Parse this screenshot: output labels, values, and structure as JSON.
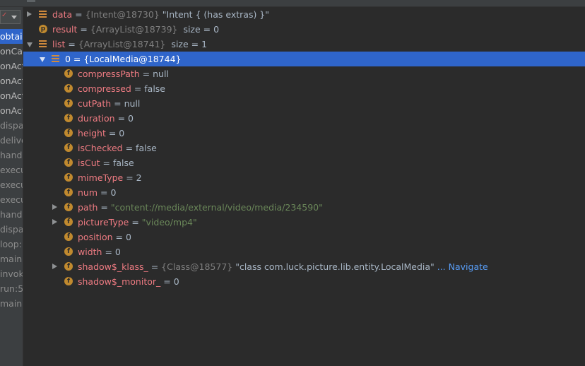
{
  "frames": [
    {
      "label": "obtai",
      "selected": true,
      "library": false
    },
    {
      "label": "onCa",
      "selected": false,
      "library": false
    },
    {
      "label": "onAct",
      "selected": false,
      "library": false
    },
    {
      "label": "onAct",
      "selected": false,
      "library": false
    },
    {
      "label": "onAct",
      "selected": false,
      "library": false
    },
    {
      "label": "onAct",
      "selected": false,
      "library": false
    },
    {
      "label": "dispa",
      "selected": false,
      "library": true
    },
    {
      "label": "delive",
      "selected": false,
      "library": true
    },
    {
      "label": "handl",
      "selected": false,
      "library": true
    },
    {
      "label": "execu",
      "selected": false,
      "library": true
    },
    {
      "label": "execu",
      "selected": false,
      "library": true
    },
    {
      "label": "execu",
      "selected": false,
      "library": true
    },
    {
      "label": "handl",
      "selected": false,
      "library": true
    },
    {
      "label": "dispa",
      "selected": false,
      "library": true
    },
    {
      "label": "loop:",
      "selected": false,
      "library": true
    },
    {
      "label": "main:",
      "selected": false,
      "library": true
    },
    {
      "label": "invok",
      "selected": false,
      "library": true
    },
    {
      "label": "run:5",
      "selected": false,
      "library": true
    },
    {
      "label": "main:",
      "selected": false,
      "library": true
    }
  ],
  "variables": [
    {
      "depth": 0,
      "toggle": "collapsed",
      "icon": "v",
      "name": "data",
      "eq": " = ",
      "ref": "{Intent@18730}",
      "value": " \"Intent { (has extras) }\"",
      "vclass": "v2",
      "selected": false
    },
    {
      "depth": 0,
      "toggle": "none",
      "icon": "p",
      "name": "result",
      "eq": " = ",
      "ref": "{ArrayList@18739}",
      "value": "  size = 0",
      "vclass": "v2",
      "selected": false
    },
    {
      "depth": 0,
      "toggle": "expanded",
      "icon": "v",
      "name": "list",
      "eq": " = ",
      "ref": "{ArrayList@18741}",
      "value": "  size = 1",
      "vclass": "v2",
      "selected": false
    },
    {
      "depth": 1,
      "toggle": "expanded",
      "icon": "v",
      "name": "0",
      "eq": " = ",
      "ref": "{LocalMedia@18744}",
      "value": "",
      "vclass": "v2",
      "selected": true
    },
    {
      "depth": 2,
      "toggle": "none",
      "icon": "f",
      "name": "compressPath",
      "eq": " = ",
      "ref": "",
      "value": "null",
      "vclass": "v2",
      "selected": false
    },
    {
      "depth": 2,
      "toggle": "none",
      "icon": "f",
      "name": "compressed",
      "eq": " = ",
      "ref": "",
      "value": "false",
      "vclass": "v2",
      "selected": false
    },
    {
      "depth": 2,
      "toggle": "none",
      "icon": "f",
      "name": "cutPath",
      "eq": " = ",
      "ref": "",
      "value": "null",
      "vclass": "v2",
      "selected": false
    },
    {
      "depth": 2,
      "toggle": "none",
      "icon": "f",
      "name": "duration",
      "eq": " = ",
      "ref": "",
      "value": "0",
      "vclass": "v2",
      "selected": false
    },
    {
      "depth": 2,
      "toggle": "none",
      "icon": "f",
      "name": "height",
      "eq": " = ",
      "ref": "",
      "value": "0",
      "vclass": "v2",
      "selected": false
    },
    {
      "depth": 2,
      "toggle": "none",
      "icon": "f",
      "name": "isChecked",
      "eq": " = ",
      "ref": "",
      "value": "false",
      "vclass": "v2",
      "selected": false
    },
    {
      "depth": 2,
      "toggle": "none",
      "icon": "f",
      "name": "isCut",
      "eq": " = ",
      "ref": "",
      "value": "false",
      "vclass": "v2",
      "selected": false
    },
    {
      "depth": 2,
      "toggle": "none",
      "icon": "f",
      "name": "mimeType",
      "eq": " = ",
      "ref": "",
      "value": "2",
      "vclass": "v2",
      "selected": false
    },
    {
      "depth": 2,
      "toggle": "none",
      "icon": "f",
      "name": "num",
      "eq": " = ",
      "ref": "",
      "value": "0",
      "vclass": "v2",
      "selected": false
    },
    {
      "depth": 2,
      "toggle": "collapsed",
      "icon": "f",
      "name": "path",
      "eq": " = ",
      "ref": "",
      "value": "\"content://media/external/video/media/234590\"",
      "vclass": "s",
      "selected": false
    },
    {
      "depth": 2,
      "toggle": "collapsed",
      "icon": "f",
      "name": "pictureType",
      "eq": " = ",
      "ref": "",
      "value": "\"video/mp4\"",
      "vclass": "s",
      "selected": false
    },
    {
      "depth": 2,
      "toggle": "none",
      "icon": "f",
      "name": "position",
      "eq": " = ",
      "ref": "",
      "value": "0",
      "vclass": "v2",
      "selected": false
    },
    {
      "depth": 2,
      "toggle": "none",
      "icon": "f",
      "name": "width",
      "eq": " = ",
      "ref": "",
      "value": "0",
      "vclass": "v2",
      "selected": false
    },
    {
      "depth": 2,
      "toggle": "collapsed",
      "icon": "f",
      "name": "shadow$_klass_",
      "eq": " = ",
      "ref": "{Class@18577}",
      "value": " \"class com.luck.picture.lib.entity.LocalMedia\"",
      "vclass": "v2",
      "nav": " ... Navigate",
      "selected": false
    },
    {
      "depth": 2,
      "toggle": "none",
      "icon": "f",
      "name": "shadow$_monitor_",
      "eq": " = ",
      "ref": "",
      "value": "0",
      "vclass": "v2",
      "selected": false
    }
  ],
  "icons": {
    "field": "f",
    "parameter": "p"
  }
}
